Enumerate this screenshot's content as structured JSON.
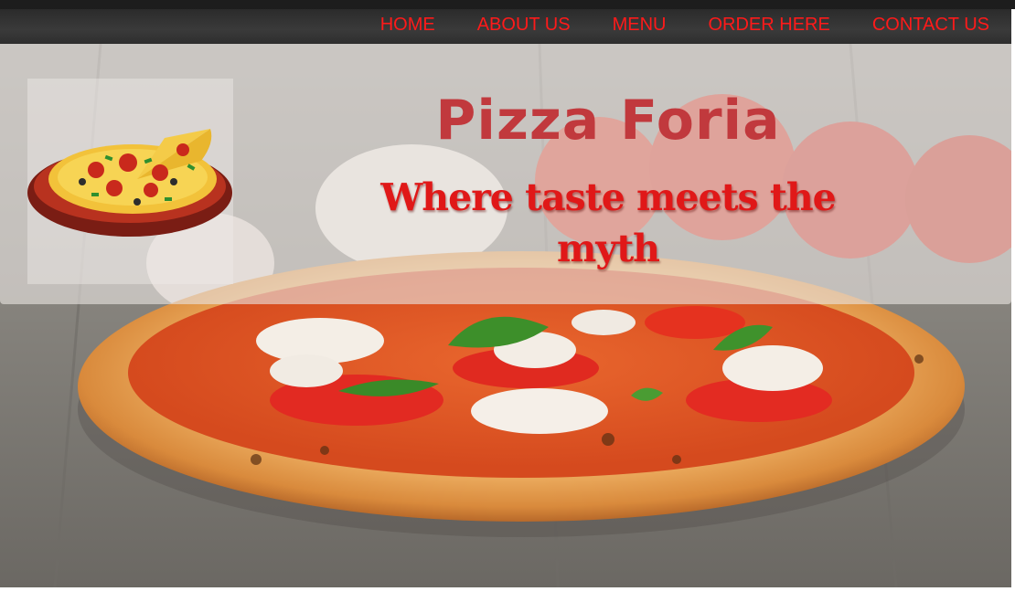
{
  "nav": {
    "items": [
      {
        "label": "HOME"
      },
      {
        "label": "ABOUT US"
      },
      {
        "label": "MENU"
      },
      {
        "label": "ORDER HERE"
      },
      {
        "label": "CONTACT US"
      }
    ]
  },
  "header": {
    "title": "Pizza Foria",
    "tagline": "Where taste meets the myth"
  },
  "colors": {
    "nav_text": "#ff1a1a",
    "nav_bg": "#2e2e2e",
    "title": "#c1393d",
    "tagline": "#e01818"
  },
  "icons": {
    "logo": "pizza-logo-icon",
    "hero": "pizza-hero-image"
  }
}
